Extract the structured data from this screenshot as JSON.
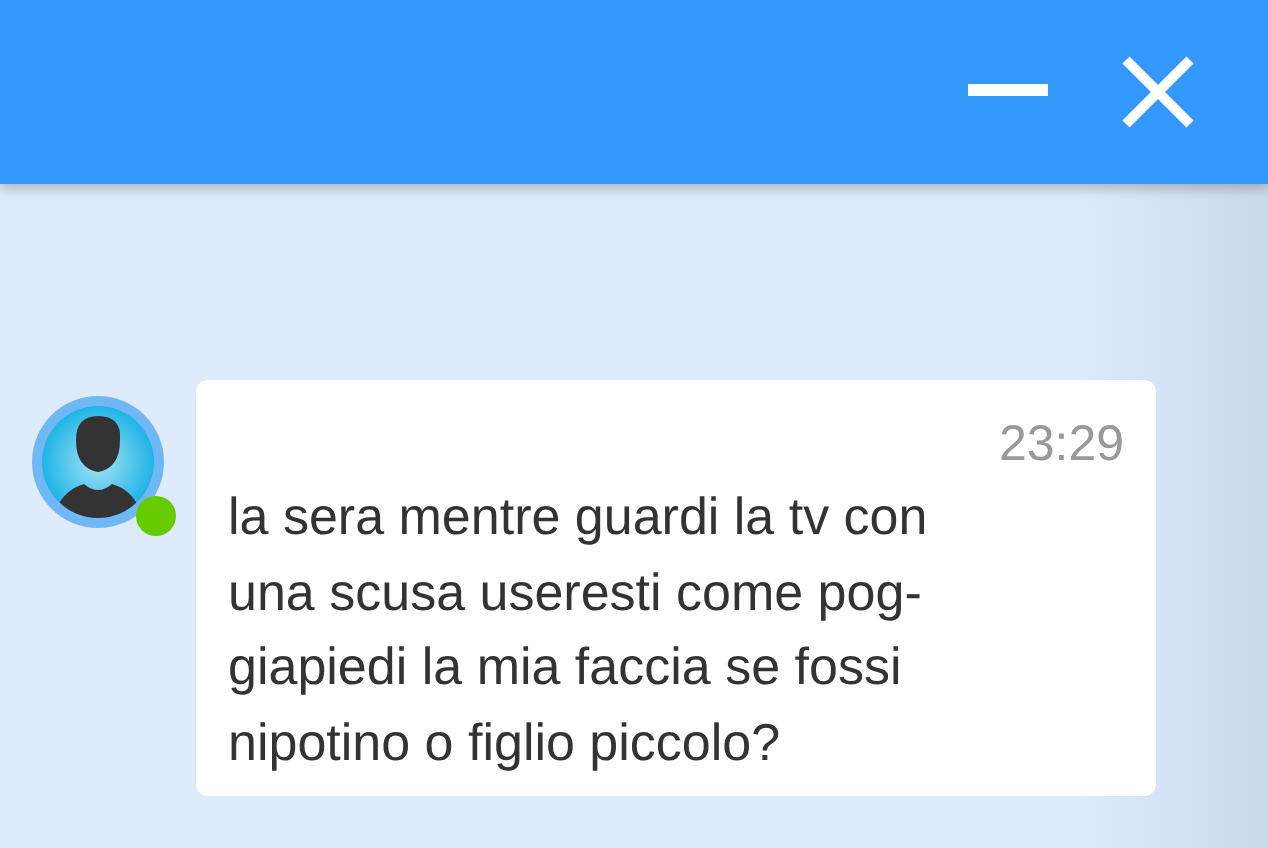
{
  "window": {
    "controls": [
      {
        "kind": "minimize"
      },
      {
        "kind": "close"
      }
    ]
  },
  "messages": [
    {
      "time": "23:29",
      "online": true,
      "lines": [
        "la sera mentre guardi la tv con",
        "una scusa useresti come pog-",
        "giapiedi la mia faccia se fossi",
        "nipotino o figlio piccolo?"
      ]
    }
  ]
}
